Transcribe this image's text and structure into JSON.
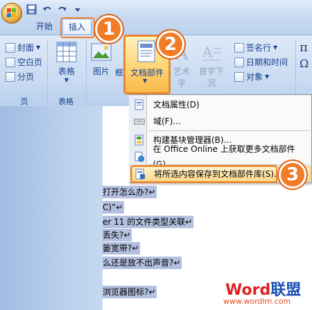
{
  "tabs": [
    {
      "label": "开始"
    },
    {
      "label": "插入"
    }
  ],
  "ribbon": {
    "pages_group": {
      "label": "页",
      "items": [
        "封面",
        "空白页",
        "分页"
      ]
    },
    "tables_group": {
      "label": "表格",
      "button": "表格"
    },
    "illustrations": {
      "picture": "图片",
      "box": "框"
    },
    "text_group": {
      "quick_parts": "文档部件",
      "wordart": "艺术字",
      "dropcap": "首字下沉",
      "signature_line": "签名行",
      "date_time": "日期和时间",
      "object": "对象"
    },
    "symbols": {
      "pi": "π",
      "omega": "Ω"
    }
  },
  "menu": {
    "items": [
      {
        "label": "文档属性(D)"
      },
      {
        "label": "域(F)..."
      },
      {
        "label": "构建基块管理器(B)..."
      },
      {
        "label": "在 Office Online 上获取更多文档部件(G)..."
      },
      {
        "label": "将所选内容保存到文档部件库(S)..."
      }
    ]
  },
  "document": {
    "lines": [
      "打开怎么办?↵",
      "C)”↵",
      "er 11 的文件类型关联↵",
      "丢失?↵",
      "篓宽带?↵",
      "么还是放不出声音?↵",
      "浏览器图标?↵"
    ]
  },
  "callouts": [
    "1",
    "2",
    "3"
  ],
  "watermark": {
    "brand_word": "Word",
    "brand_cn": "联盟",
    "url": "www.wordlm.com"
  },
  "colors": {
    "ribbon": "#c7d9f1",
    "accent": "#f07b28",
    "selection": "#b3c0e0",
    "brand_red": "#e02020",
    "brand_blue": "#1a4fb5"
  }
}
